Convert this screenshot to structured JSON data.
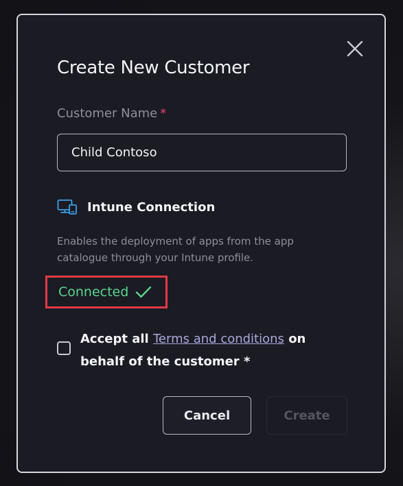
{
  "dialog": {
    "title": "Create New Customer",
    "close_icon": "close-icon"
  },
  "customer_name": {
    "label": "Customer Name",
    "required_marker": "*",
    "value": "Child Contoso"
  },
  "intune": {
    "icon": "devices-icon",
    "heading": "Intune Connection",
    "description": "Enables the deployment of apps from the app catalogue through your Intune profile.",
    "status": "Connected",
    "status_icon": "checkmark-icon",
    "status_color": "#58d68d",
    "highlight_color": "#e23a45"
  },
  "terms": {
    "checked": false,
    "prefix": "Accept all ",
    "link_text": "Terms and conditions",
    "suffix": " on behalf of the customer *"
  },
  "actions": {
    "cancel_label": "Cancel",
    "create_label": "Create",
    "create_disabled": true
  }
}
